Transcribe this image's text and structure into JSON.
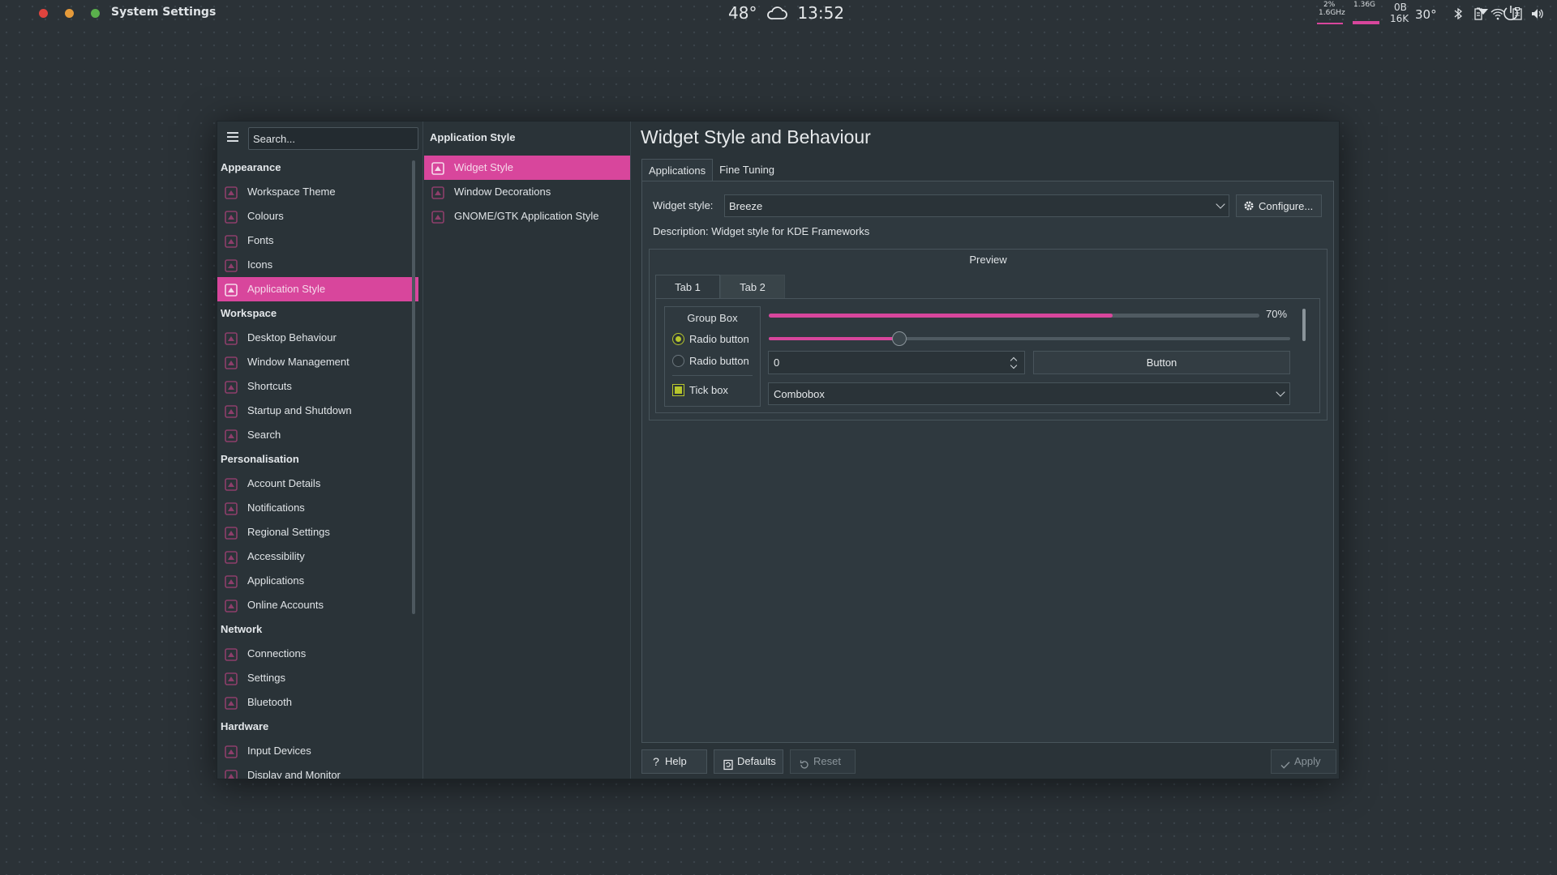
{
  "topbar": {
    "app_title": "System Settings",
    "temperature": "48°",
    "time": "13:52",
    "cpu_percent": "2%",
    "cpu_freq": "1.6GHz",
    "mem_used": "1.36G",
    "net_up": "0B",
    "net_down": "16K",
    "cpu_temp": "30°",
    "colors": {
      "close": "#e0443e",
      "minimize": "#e59a3a",
      "maximize": "#5ab04c",
      "accent": "#d8469c"
    }
  },
  "sidebar": {
    "search_placeholder": "Search...",
    "categories": [
      {
        "label": "Appearance",
        "items": [
          {
            "label": "Workspace Theme",
            "icon": "workspace-theme-icon"
          },
          {
            "label": "Colours",
            "icon": "colours-icon"
          },
          {
            "label": "Fonts",
            "icon": "fonts-icon"
          },
          {
            "label": "Icons",
            "icon": "icons-icon"
          },
          {
            "label": "Application Style",
            "icon": "application-style-icon",
            "active": true
          }
        ]
      },
      {
        "label": "Workspace",
        "items": [
          {
            "label": "Desktop Behaviour",
            "icon": "desktop-behaviour-icon"
          },
          {
            "label": "Window Management",
            "icon": "window-management-icon"
          },
          {
            "label": "Shortcuts",
            "icon": "shortcuts-icon"
          },
          {
            "label": "Startup and Shutdown",
            "icon": "startup-shutdown-icon"
          },
          {
            "label": "Search",
            "icon": "search-icon"
          }
        ]
      },
      {
        "label": "Personalisation",
        "items": [
          {
            "label": "Account Details",
            "icon": "account-details-icon"
          },
          {
            "label": "Notifications",
            "icon": "notifications-icon"
          },
          {
            "label": "Regional Settings",
            "icon": "regional-settings-icon"
          },
          {
            "label": "Accessibility",
            "icon": "accessibility-icon"
          },
          {
            "label": "Applications",
            "icon": "applications-icon"
          },
          {
            "label": "Online Accounts",
            "icon": "online-accounts-icon"
          }
        ]
      },
      {
        "label": "Network",
        "items": [
          {
            "label": "Connections",
            "icon": "connections-icon"
          },
          {
            "label": "Settings",
            "icon": "network-settings-icon"
          },
          {
            "label": "Bluetooth",
            "icon": "bluetooth-icon"
          }
        ]
      },
      {
        "label": "Hardware",
        "items": [
          {
            "label": "Input Devices",
            "icon": "input-devices-icon"
          },
          {
            "label": "Display and Monitor",
            "icon": "display-monitor-icon"
          }
        ]
      }
    ]
  },
  "subpanel": {
    "title": "Application Style",
    "items": [
      {
        "label": "Widget Style",
        "icon": "widget-style-icon",
        "active": true
      },
      {
        "label": "Window Decorations",
        "icon": "window-decorations-icon"
      },
      {
        "label": "GNOME/GTK Application Style",
        "icon": "gnome-gtk-icon"
      }
    ]
  },
  "content": {
    "title": "Widget Style and Behaviour",
    "tabs": [
      "Applications",
      "Fine Tuning"
    ],
    "widget_style_label": "Widget style:",
    "widget_style_value": "Breeze",
    "configure_label": "Configure...",
    "description": "Description: Widget style for KDE Frameworks",
    "preview": {
      "title": "Preview",
      "tabs": [
        "Tab 1",
        "Tab 2"
      ],
      "group_box_title": "Group Box",
      "radio1": "Radio button",
      "radio2": "Radio button",
      "tickbox": "Tick box",
      "progress_value": 70,
      "progress_label": "70%",
      "slider_value": 0.25,
      "spinbox_value": "0",
      "button_label": "Button",
      "combobox_value": "Combobox"
    }
  },
  "footer": {
    "help": "Help",
    "defaults": "Defaults",
    "reset": "Reset",
    "apply": "Apply"
  }
}
